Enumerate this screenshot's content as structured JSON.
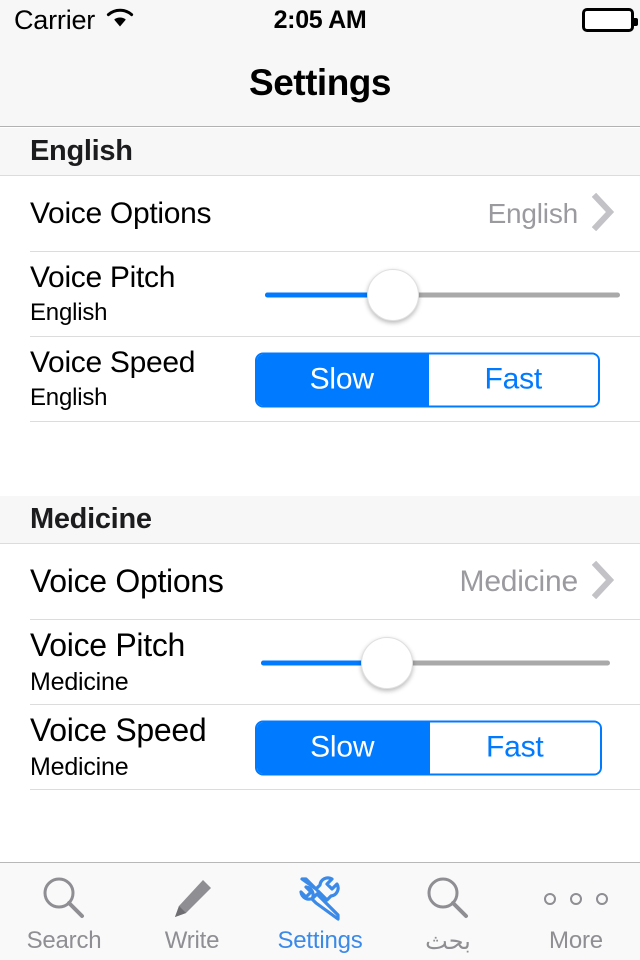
{
  "status_bar": {
    "carrier": "Carrier",
    "wifi_icon": "wifi-icon",
    "time": "2:05 AM",
    "battery_icon": "battery-full-icon"
  },
  "nav": {
    "title": "Settings"
  },
  "colors": {
    "accent_blue": "#007AFF",
    "tab_active_blue": "#3B8AE8",
    "value_gray": "#9A9A9F",
    "chevron_gray": "#C7C7CC",
    "separator": "#DCDCDC",
    "header_bg": "#F7F7F7",
    "track_gray": "#A9A9A9"
  },
  "sections": [
    {
      "header": "English",
      "voice_options": {
        "title": "Voice Options",
        "value": "English",
        "chevron_icon": "chevron-right-icon"
      },
      "voice_pitch": {
        "title": "Voice Pitch",
        "subtitle": "English",
        "slider_percent": 36
      },
      "voice_speed": {
        "title": "Voice Speed",
        "subtitle": "English",
        "options": [
          "Slow",
          "Fast"
        ],
        "selected": "Slow"
      }
    },
    {
      "header": "Medicine",
      "voice_options": {
        "title": "Voice Options",
        "value": "Medicine",
        "chevron_icon": "chevron-right-icon"
      },
      "voice_pitch": {
        "title": "Voice Pitch",
        "subtitle": "Medicine",
        "slider_percent": 36
      },
      "voice_speed": {
        "title": "Voice Speed",
        "subtitle": "Medicine",
        "options": [
          "Slow",
          "Fast"
        ],
        "selected": "Slow"
      }
    }
  ],
  "tabbar": {
    "items": [
      {
        "label": "Search",
        "icon": "magnifier-icon",
        "active": false
      },
      {
        "label": "Write",
        "icon": "pencil-icon",
        "active": false
      },
      {
        "label": "Settings",
        "icon": "wrench-screwdriver-icon",
        "active": true
      },
      {
        "label": "بحث",
        "icon": "magnifier-icon",
        "active": false
      },
      {
        "label": "More",
        "icon": "three-dots-icon",
        "active": false
      }
    ]
  }
}
